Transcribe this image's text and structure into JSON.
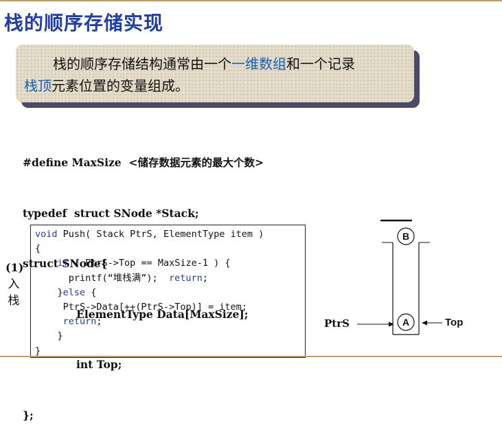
{
  "slide": {
    "title": "栈的顺序存储实现"
  },
  "note": {
    "part1": "栈的顺序存储结构通常由一个",
    "highlight1": "一维数组",
    "part2": "和一个记录",
    "highlight2": "栈顶",
    "part3": "元素位置的变量组成。"
  },
  "definitions": {
    "line1": "#define MaxSize  <储存数据元素的最大个数>",
    "line2": "typedef  struct SNode *Stack;",
    "line3": "struct SNode{",
    "line4": "ElementType Data[MaxSize];",
    "line5": "int Top;",
    "line6": "};"
  },
  "side_label": {
    "number": "(1)",
    "char1": "入",
    "char2": "栈"
  },
  "code": {
    "l1_kw": "void",
    "l1_rest": " Push( Stack PtrS, ElementType item )",
    "l2": "{",
    "l3_pre": "    ",
    "l3_kw": "if",
    "l3_rest": " ( PtrS->Top == MaxSize-1 ) {",
    "l4_pre": "      printf(“堆栈满”);  ",
    "l4_kw": "return",
    "l4_rest": ";",
    "l5_pre": "    }",
    "l5_kw": "else",
    "l5_rest": " {",
    "l6": "     PtrS->Data[++(PtrS->Top)] = item;",
    "l7_pre": "     ",
    "l7_kw": "return",
    "l7_rest": ";",
    "l8": "    }",
    "l9": "}"
  },
  "diagram": {
    "ptrs_label": "PtrS",
    "top_label": "Top",
    "node_a": "A",
    "node_b": "B"
  }
}
